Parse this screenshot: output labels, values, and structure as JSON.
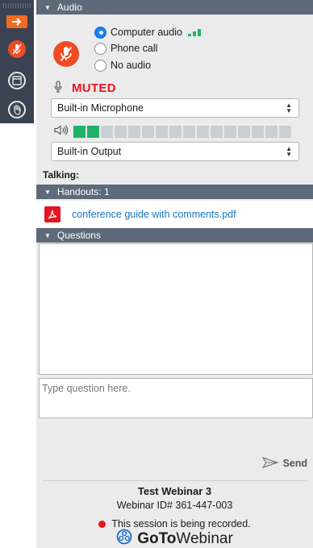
{
  "toolbar": {
    "icons": [
      "arrow-right-icon",
      "mic-muted-icon",
      "panel-icon",
      "raise-hand-icon"
    ],
    "accent": "#f26b21"
  },
  "audio": {
    "header": "Audio",
    "options": [
      {
        "label": "Computer audio",
        "selected": true
      },
      {
        "label": "Phone call",
        "selected": false
      },
      {
        "label": "No audio",
        "selected": false
      }
    ],
    "status": "MUTED",
    "microphone": "Built-in Microphone",
    "output": "Built-in Output",
    "level": {
      "active_segments": 2,
      "total_segments": 16
    },
    "colors": {
      "muted": "#e8141c",
      "mic_button": "#f04b23",
      "level_on": "#1fb06a"
    }
  },
  "talking": {
    "label": "Talking:"
  },
  "handouts": {
    "header": "Handouts: 1",
    "files": [
      {
        "name": "conference guide with comments.pdf"
      }
    ]
  },
  "questions": {
    "header": "Questions",
    "input_placeholder": "Type question here.",
    "send_label": "Send"
  },
  "session": {
    "title": "Test Webinar 3",
    "id_text": "Webinar ID# 361-447-003",
    "recording_text": "This session is being recorded."
  },
  "brand": {
    "goto": "GoTo",
    "webinar": "Webinar"
  }
}
